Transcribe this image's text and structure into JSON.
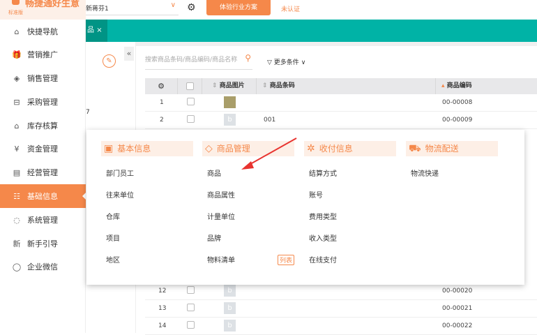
{
  "header": {
    "app_title": "畅捷通好生意",
    "edition": "标准版",
    "store": "新蒋芬1",
    "trial_button": "体验行业方案",
    "auth_status": "未认证"
  },
  "tabs": [
    {
      "label": "品",
      "close": "×"
    }
  ],
  "sidebar": {
    "items": [
      {
        "label": "快捷导航",
        "icon": "⌂"
      },
      {
        "label": "营销推广",
        "icon": "🎁"
      },
      {
        "label": "销售管理",
        "icon": "◈"
      },
      {
        "label": "采购管理",
        "icon": "⊟"
      },
      {
        "label": "库存核算",
        "icon": "⌂"
      },
      {
        "label": "资金管理",
        "icon": "¥"
      },
      {
        "label": "经营管理",
        "icon": "▤"
      },
      {
        "label": "基础信息",
        "icon": "☷",
        "active": true
      },
      {
        "label": "系统管理",
        "icon": "◌"
      },
      {
        "label": "新手引导",
        "icon": "新"
      },
      {
        "label": "企业微信",
        "icon": "◯"
      }
    ]
  },
  "left_panel": {
    "partial_text": "7",
    "collapse": "«",
    "edit": "✎"
  },
  "toolbar": {
    "search_placeholder": "搜索商品条码/商品编码/商品名称",
    "more_filters": "更多条件"
  },
  "table": {
    "columns": [
      "商品图片",
      "商品条码",
      "商品编码"
    ],
    "rows": [
      {
        "index": "1",
        "barcode": "",
        "code": "00-00008"
      },
      {
        "index": "2",
        "barcode": "001",
        "code": "00-00009"
      },
      {
        "index": "12",
        "barcode": "",
        "code": "00-00020"
      },
      {
        "index": "13",
        "barcode": "",
        "code": "00-00021"
      },
      {
        "index": "14",
        "barcode": "",
        "code": "00-00022"
      }
    ]
  },
  "menu": {
    "columns": [
      {
        "title": "基本信息",
        "icon": "▣",
        "items": [
          "部门员工",
          "往来单位",
          "仓库",
          "项目",
          "地区"
        ]
      },
      {
        "title": "商品管理",
        "icon": "◇",
        "items": [
          "商品",
          "商品属性",
          "计量单位",
          "品牌",
          "物料清单"
        ],
        "badge": "列表"
      },
      {
        "title": "收付信息",
        "icon": "✲",
        "items": [
          "结算方式",
          "账号",
          "费用类型",
          "收入类型",
          "在线支付"
        ]
      },
      {
        "title": "物流配送",
        "icon": "⛟",
        "items": [
          "物流快递"
        ]
      }
    ]
  },
  "colors": {
    "accent": "#f5884a",
    "teal": "#00b3a6"
  }
}
